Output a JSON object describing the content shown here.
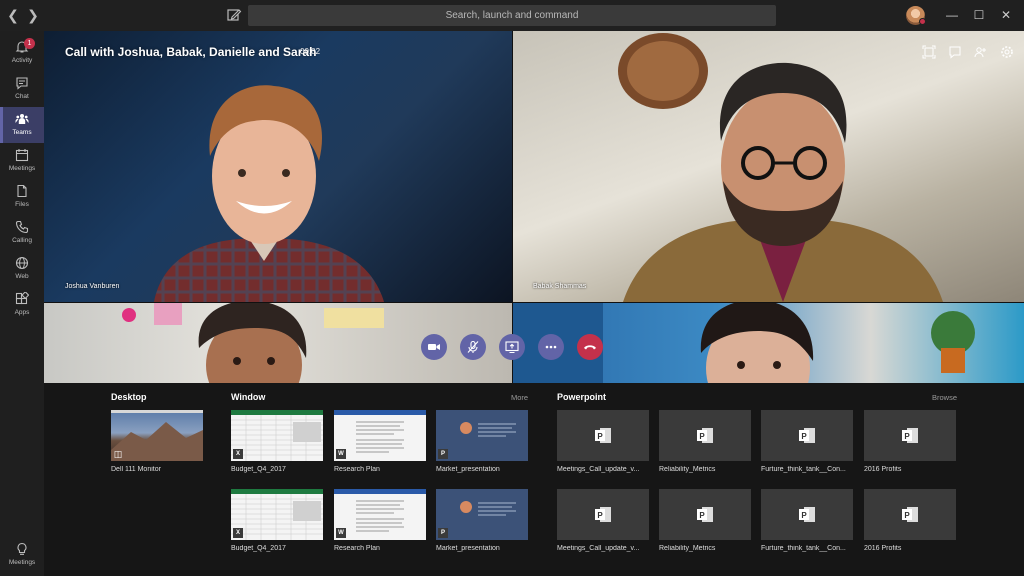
{
  "titlebar": {
    "search_placeholder": "Search, launch and command"
  },
  "rail": {
    "items": [
      {
        "label": "Activity",
        "icon": "bell-icon",
        "badge": "1"
      },
      {
        "label": "Chat",
        "icon": "chat-icon"
      },
      {
        "label": "Teams",
        "icon": "teams-icon",
        "active": true
      },
      {
        "label": "Meetings",
        "icon": "calendar-icon"
      },
      {
        "label": "Files",
        "icon": "file-icon"
      },
      {
        "label": "Calling",
        "icon": "phone-icon"
      },
      {
        "label": "Web",
        "icon": "globe-icon"
      },
      {
        "label": "Apps",
        "icon": "apps-icon"
      }
    ],
    "bottom": {
      "label": "Meetings",
      "icon": "lightbulb-icon"
    }
  },
  "call": {
    "title": "Call with Joshua, Babak, Danielle and Sarah",
    "timer": "00:02",
    "participants": [
      {
        "name": "Joshua Vanburen"
      },
      {
        "name": "Babak Shammas"
      }
    ]
  },
  "tray": {
    "desktop": {
      "title": "Desktop",
      "items": [
        {
          "label": "Dell 111 Monitor"
        }
      ]
    },
    "window": {
      "title": "Window",
      "more_label": "More",
      "items": [
        {
          "label": "Budget_Q4_2017",
          "app": "excel"
        },
        {
          "label": "Research Plan",
          "app": "word"
        },
        {
          "label": "Market_presentation",
          "app": "powerpoint"
        },
        {
          "label": "Budget_Q4_2017",
          "app": "excel"
        },
        {
          "label": "Research Plan",
          "app": "word"
        },
        {
          "label": "Market_presentation",
          "app": "powerpoint"
        }
      ]
    },
    "powerpoint": {
      "title": "Powerpoint",
      "browse_label": "Browse",
      "items": [
        {
          "label": "Meetings_Call_update_v..."
        },
        {
          "label": "Reliability_Metrics"
        },
        {
          "label": "Furture_think_tank__Con..."
        },
        {
          "label": "2016 Profits"
        },
        {
          "label": "Meetings_Call_update_v..."
        },
        {
          "label": "Reliability_Metrics"
        },
        {
          "label": "Furture_think_tank__Con..."
        },
        {
          "label": "2016 Profits"
        }
      ]
    }
  },
  "colors": {
    "accent": "#6264a7",
    "hangup": "#c4314b",
    "badge": "#c4314b"
  }
}
